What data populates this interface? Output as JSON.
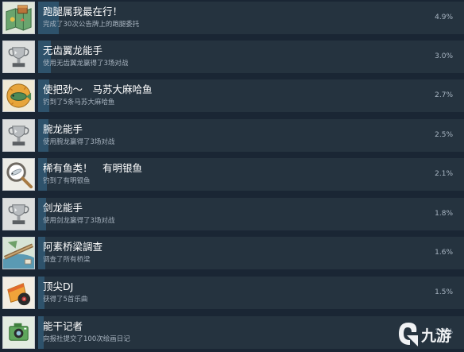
{
  "achievements": [
    {
      "icon": "map-treasure-icon",
      "title": "跑腿属我最在行！",
      "description": "完成了30次公告牌上的跑腿委托",
      "percent": "4.9%",
      "progress": 0.049
    },
    {
      "icon": "trophy-icon",
      "title": "无齿翼龙能手",
      "description": "使用无齿翼龙赢得了3场对战",
      "percent": "3.0%",
      "progress": 0.03
    },
    {
      "icon": "fish-icon",
      "title": "使把劲～　马苏大麻哈鱼",
      "description": "钓到了5条马苏大麻哈鱼",
      "percent": "2.7%",
      "progress": 0.027
    },
    {
      "icon": "trophy-icon",
      "title": "腕龙能手",
      "description": "使用腕龙赢得了3场对战",
      "percent": "2.5%",
      "progress": 0.025
    },
    {
      "icon": "magnifier-fish-icon",
      "title": "稀有鱼类！　有明银鱼",
      "description": "钓到了有明银鱼",
      "percent": "2.1%",
      "progress": 0.021
    },
    {
      "icon": "trophy-icon",
      "title": "剑龙能手",
      "description": "使用剑龙赢得了3场对战",
      "percent": "1.8%",
      "progress": 0.018
    },
    {
      "icon": "bridge-map-icon",
      "title": "阿素桥梁調查",
      "description": "调查了所有桥梁",
      "percent": "1.6%",
      "progress": 0.016
    },
    {
      "icon": "dj-record-icon",
      "title": "顶尖DJ",
      "description": "获得了5首乐曲",
      "percent": "1.5%",
      "progress": 0.015
    },
    {
      "icon": "camera-reporter-icon",
      "title": "能干记者",
      "description": "向报社提交了100次绘画日记",
      "percent": "1.3%",
      "progress": 0.013
    }
  ],
  "watermark": {
    "text": "九游"
  },
  "colors": {
    "background": "#1a2634",
    "bar": "#25333f",
    "progress_fill": "#2e526b",
    "title": "#ffffff",
    "description": "#a7b3bf"
  }
}
